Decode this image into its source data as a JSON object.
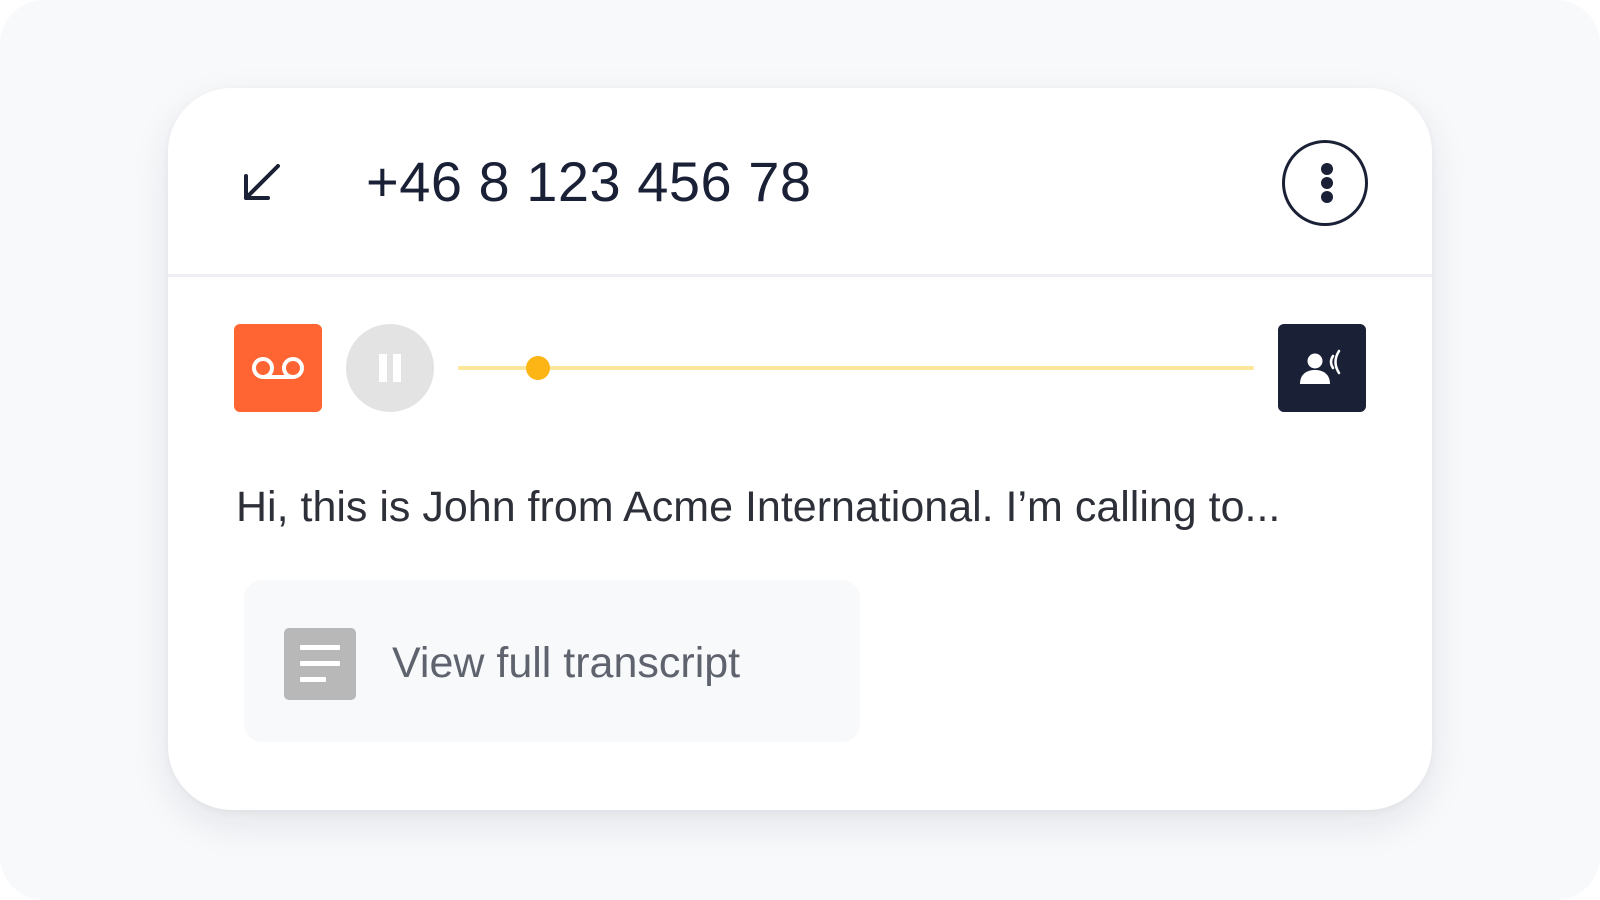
{
  "call": {
    "direction_icon": "arrow-down-left-icon",
    "phone_number": "+46 8 123 456 78",
    "more_icon": "vertical-dots-icon"
  },
  "player": {
    "voicemail_icon": "voicemail-icon",
    "pause_icon": "pause-icon",
    "progress_fraction": 0.1,
    "speaker_icon": "person-speaking-icon"
  },
  "transcript": {
    "preview_text": "Hi, this is John from Acme International. I’m calling to...",
    "button_label": "View full transcript",
    "button_icon": "document-lines-icon"
  },
  "colors": {
    "voicemail_accent": "#ff6533",
    "progress_thumb": "#fdb515",
    "progress_track": "#fbe79a",
    "dark": "#1a2035"
  }
}
